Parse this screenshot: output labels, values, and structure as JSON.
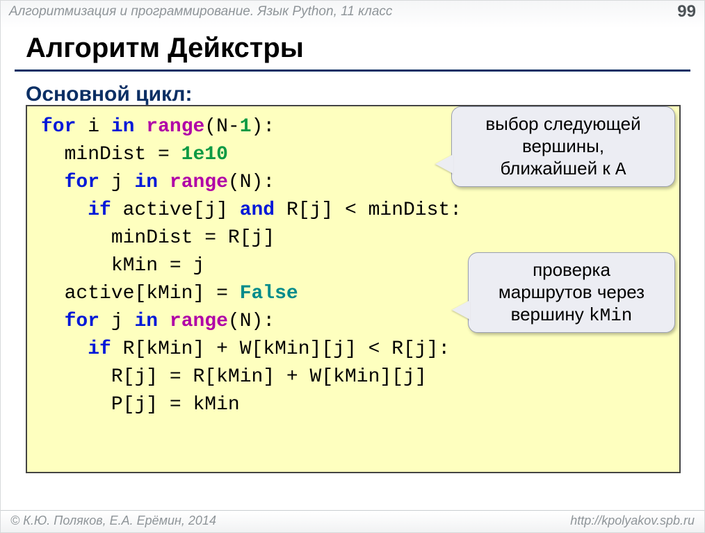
{
  "header": {
    "course": "Алгоритмизация и программирование. Язык Python, 11 класс",
    "page": "99"
  },
  "title": "Алгоритм Дейкстры",
  "subtitle": "Основной цикл:",
  "callouts": {
    "c1": {
      "l1": "выбор следующей",
      "l2": "вершины,",
      "l3_pre": "ближайшей к ",
      "l3_mono": "A"
    },
    "c2": {
      "l1": "проверка",
      "l2": "маршрутов через",
      "l3_pre": "вершину ",
      "l3_mono": "kMin"
    }
  },
  "code": {
    "kw_for": "for",
    "kw_in": "in",
    "kw_if": "if",
    "kw_and": "and",
    "fn_range": "range",
    "val_false": "False",
    "num_1": "1",
    "num_1e10": "1e10",
    "ids": {
      "i": "i",
      "j": "j",
      "N": "N",
      "minDist": "minDist",
      "active": "active",
      "R": "R",
      "kMin": "kMin",
      "W": "W",
      "P": "P"
    },
    "lines": [
      "for i in range(N-1):",
      "  minDist = 1e10",
      "  for j in range(N):",
      "    if active[j] and R[j] < minDist:",
      "      minDist = R[j]",
      "      kMin = j",
      "  active[kMin] = False",
      "  for j in range(N):",
      "    if R[kMin] + W[kMin][j] < R[j]:",
      "      R[j] = R[kMin] + W[kMin][j]",
      "      P[j] = kMin"
    ]
  },
  "footer": {
    "authors": "© К.Ю. Поляков, Е.А. Ерёмин, 2014",
    "url": "http://kpolyakov.spb.ru"
  }
}
